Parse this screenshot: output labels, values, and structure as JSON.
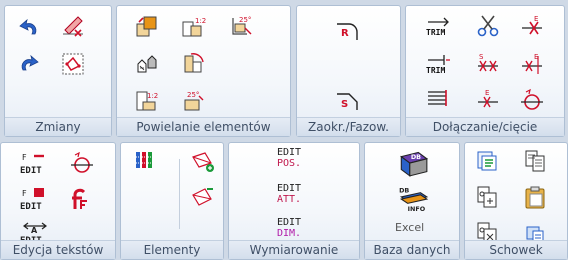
{
  "groups": {
    "zmiany": {
      "label": "Zmiany"
    },
    "powielanie": {
      "label": "Powielanie elementów"
    },
    "zaokr": {
      "label": "Zaokr./Fazow."
    },
    "dolaczanie": {
      "label": "Dołączanie/cięcie"
    },
    "edycja": {
      "label": "Edycja tekstów"
    },
    "elementy": {
      "label": "Elementy"
    },
    "wymiarowanie": {
      "label": "Wymiarowanie"
    },
    "baza": {
      "label": "Baza danych"
    },
    "schowek": {
      "label": "Schowek"
    }
  },
  "icon_texts": {
    "trim": "TRIM",
    "scale_ratio": "1:2",
    "angle_deg": "25°",
    "edit": "EDIT",
    "font_f": "F",
    "radius_r": "R",
    "chamfer_s": "S",
    "break_s": "S",
    "break_e": "E",
    "db": "DB",
    "info": "INFO"
  },
  "wymiarowanie": {
    "edit_pos_line1": "EDIT",
    "edit_pos_line2": "POS.",
    "edit_att_line1": "EDIT",
    "edit_att_line2": "ATT.",
    "edit_dim_line1": "EDIT",
    "edit_dim_line2": "DIM."
  },
  "baza": {
    "excel_label": "Excel"
  },
  "colors": {
    "accent_red": "#d0102a",
    "accent_blue": "#2a62c8",
    "accent_orange": "#e89417",
    "label_text": "#3f4f66"
  }
}
